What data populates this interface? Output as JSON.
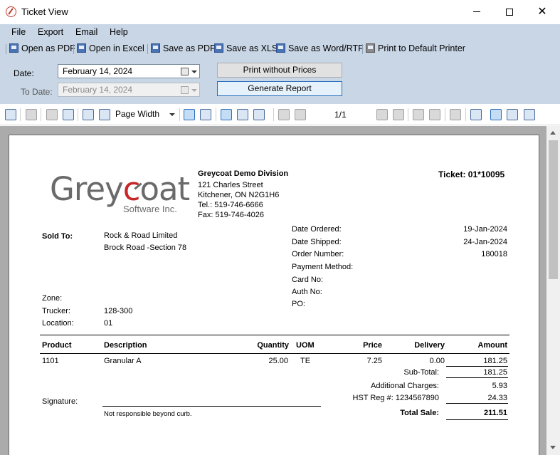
{
  "window": {
    "title": "Ticket View"
  },
  "menu": [
    "File",
    "Export",
    "Email",
    "Help"
  ],
  "toolbar": {
    "open_pdf": "Open as PDF",
    "open_excel": "Open in Excel",
    "save_pdf": "Save as PDF",
    "save_xls": "Save as XLS",
    "save_word": "Save as Word/RTF",
    "print_default": "Print to Default Printer"
  },
  "form": {
    "date_label": "Date:",
    "date_value": "February  14, 2024",
    "to_date_label": "To Date:",
    "to_date_value": "February  14, 2024",
    "print_without_prices": "Print without Prices",
    "generate_report": "Generate Report"
  },
  "viewer": {
    "zoom": "Page Width",
    "page": "1/1"
  },
  "report": {
    "company": {
      "logo_word": "Greycoat",
      "logo_sub": "Software Inc.",
      "name": "Greycoat Demo Division",
      "street": "121 Charles Street",
      "city": "Kitchener, ON N2G1H6",
      "tel": "Tel.: 519-746-6666",
      "fax": "Fax: 519-746-4026"
    },
    "ticket": "Ticket: 01*10095",
    "sold_to_label": "Sold To:",
    "sold_to_name": "Rock & Road Limited",
    "sold_to_addr": "Brock Road -Section 78",
    "info_labels": [
      "Date Ordered:",
      "Date Shipped:",
      "Order Number:",
      "Payment Method:",
      "Card No:",
      "Auth No:",
      "PO:"
    ],
    "info_values": [
      "19-Jan-2024",
      "24-Jan-2024",
      "180018",
      "",
      "",
      "",
      ""
    ],
    "zone_label": "Zone:",
    "trucker_label": "Trucker:",
    "trucker_value": "128-300",
    "location_label": "Location:",
    "location_value": "01",
    "columns": [
      "Product",
      "Description",
      "Quantity",
      "UOM",
      "Price",
      "Delivery",
      "Amount"
    ],
    "rows": [
      {
        "product": "1101",
        "description": "Granular A",
        "quantity": "25.00",
        "uom": "TE",
        "price": "7.25",
        "delivery": "0.00",
        "amount": "181.25"
      }
    ],
    "subtotal_label": "Sub-Total:",
    "subtotal_value": "181.25",
    "additional_label": "Additional Charges:",
    "additional_value": "5.93",
    "hst_label": "HST Reg #: 1234567890",
    "hst_value": "24.33",
    "total_label": "Total Sale:",
    "total_value": "211.51",
    "signature_label": "Signature:",
    "disclaimer": "Not responsible beyond curb."
  }
}
